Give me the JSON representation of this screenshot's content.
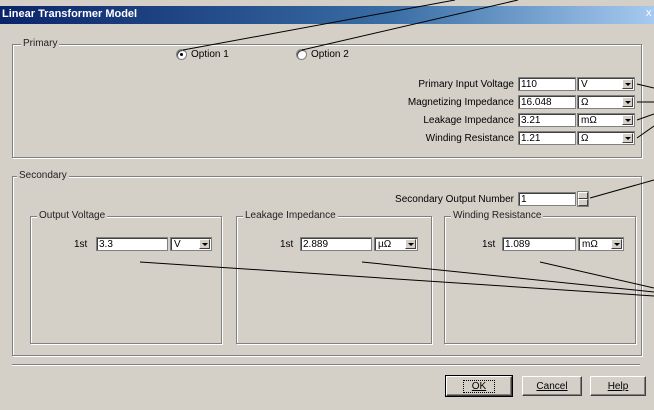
{
  "window": {
    "title": "Linear Transformer Model",
    "close_glyph": "x"
  },
  "primary": {
    "legend": "Primary",
    "option1_label": "Option 1",
    "option2_label": "Option 2",
    "selected_option": "Option 1",
    "rows": [
      {
        "label": "Primary Input Voltage",
        "value": "110",
        "unit": "V"
      },
      {
        "label": "Magnetizing Impedance",
        "value": "16.048",
        "unit": "Ω"
      },
      {
        "label": "Leakage Impedance",
        "value": "3.21",
        "unit": "mΩ"
      },
      {
        "label": "Winding Resistance",
        "value": "1.21",
        "unit": "Ω"
      }
    ]
  },
  "secondary": {
    "legend": "Secondary",
    "output_number_label": "Secondary Output Number",
    "output_number_value": "1",
    "output_voltage": {
      "legend": "Output Voltage",
      "row_label": "1st",
      "value": "3.3",
      "unit": "V"
    },
    "leakage_impedance": {
      "legend": "Leakage Impedance",
      "row_label": "1st",
      "value": "2.889",
      "unit": "µΩ"
    },
    "winding_resistance": {
      "legend": "Winding Resistance",
      "row_label": "1st",
      "value": "1.089",
      "unit": "mΩ"
    }
  },
  "buttons": {
    "ok": "OK",
    "cancel": "Cancel",
    "help": "Help"
  }
}
